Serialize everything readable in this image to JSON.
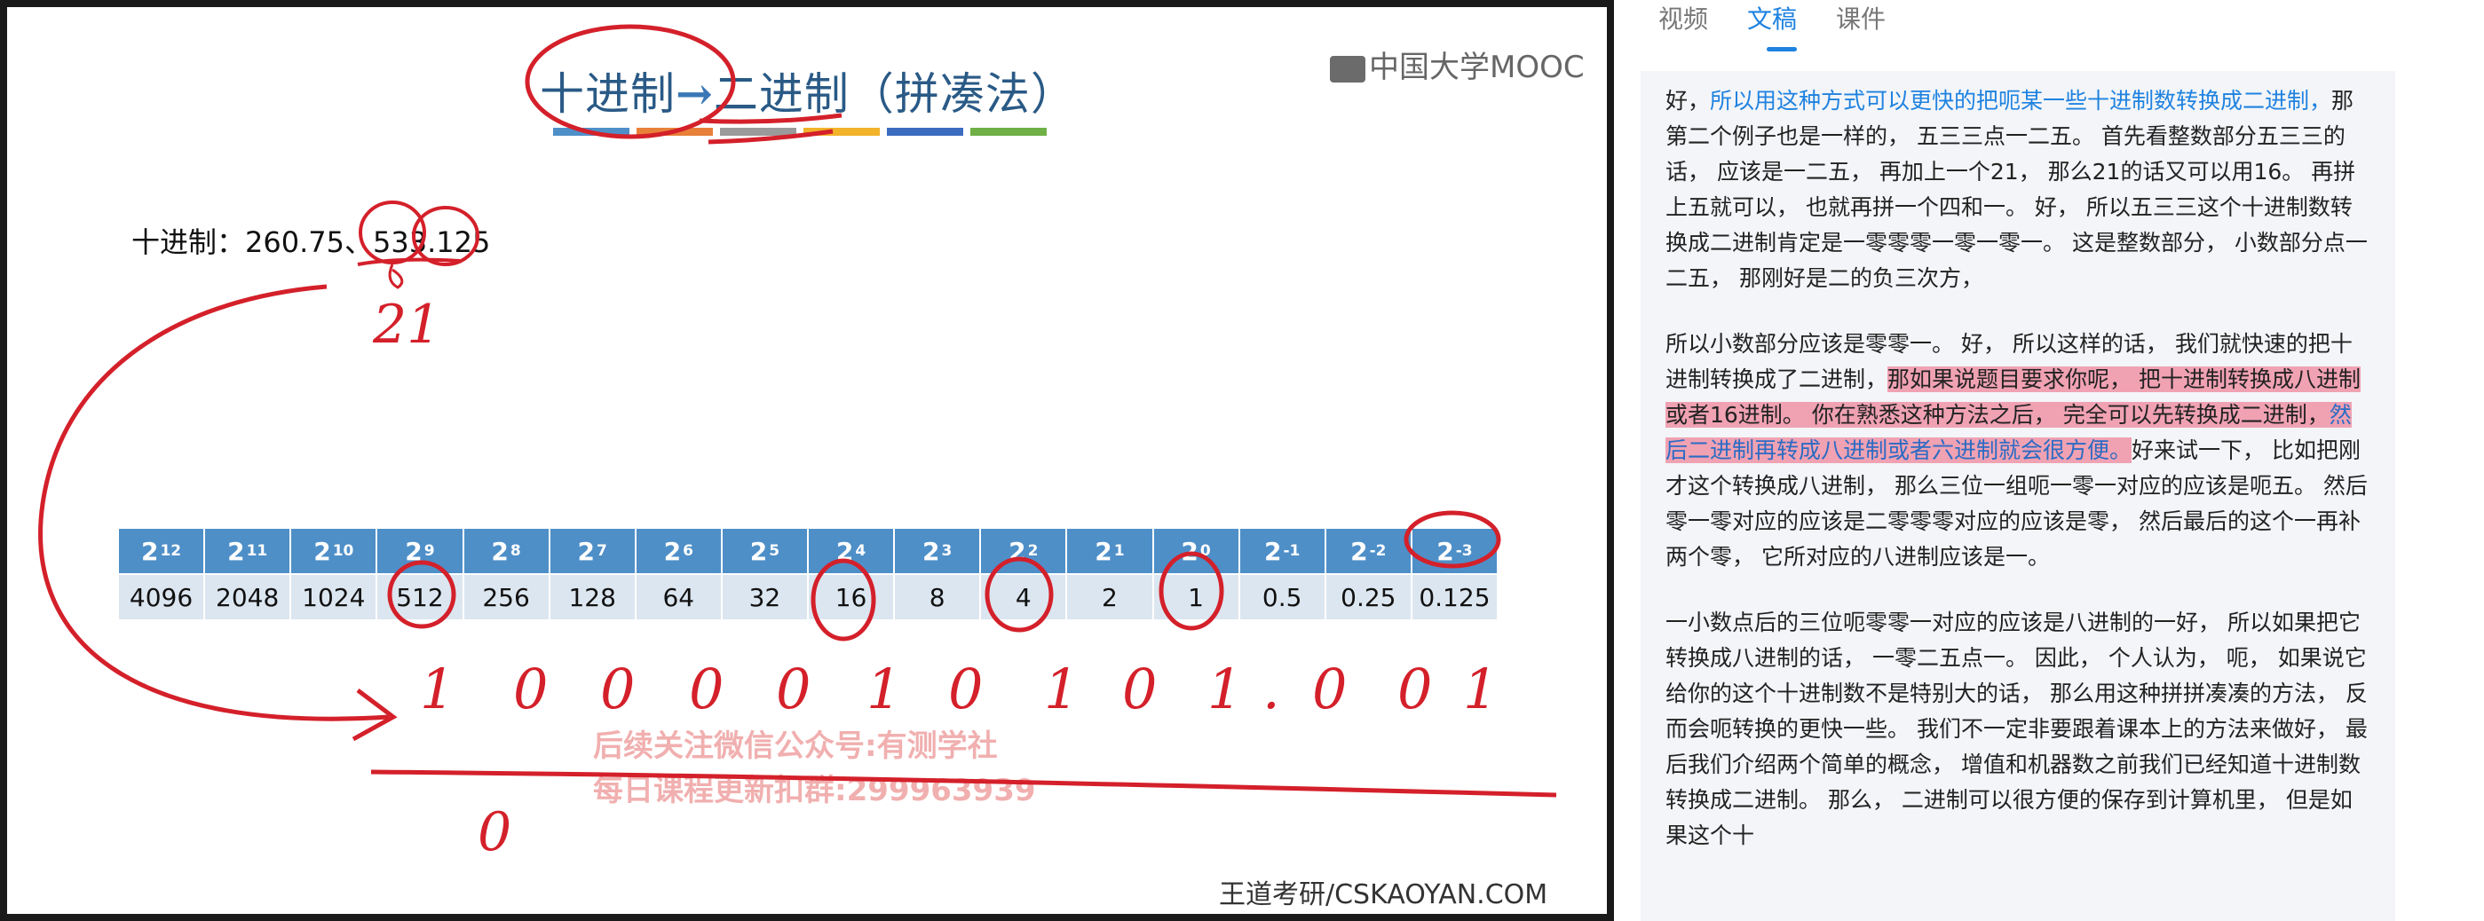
{
  "slide": {
    "title_left": "十进制",
    "title_arrow": "→",
    "title_right": "二进制（拼凑法）",
    "title_bar_colors": [
      "#4e8fc8",
      "#e8803a",
      "#9a9a9a",
      "#f2b32a",
      "#3b6cc0",
      "#6fb047"
    ],
    "logo": "中国大学MOOC",
    "decimal_label": "十进制：",
    "decimal_values": "260.75、533.125",
    "powers": [
      {
        "base": "2",
        "exp": "12"
      },
      {
        "base": "2",
        "exp": "11"
      },
      {
        "base": "2",
        "exp": "10"
      },
      {
        "base": "2",
        "exp": "9"
      },
      {
        "base": "2",
        "exp": "8"
      },
      {
        "base": "2",
        "exp": "7"
      },
      {
        "base": "2",
        "exp": "6"
      },
      {
        "base": "2",
        "exp": "5"
      },
      {
        "base": "2",
        "exp": "4"
      },
      {
        "base": "2",
        "exp": "3"
      },
      {
        "base": "2",
        "exp": "2"
      },
      {
        "base": "2",
        "exp": "1"
      },
      {
        "base": "2",
        "exp": "0"
      },
      {
        "base": "2",
        "exp": "-1"
      },
      {
        "base": "2",
        "exp": "-2"
      },
      {
        "base": "2",
        "exp": "-3"
      }
    ],
    "values": [
      "4096",
      "2048",
      "1024",
      "512",
      "256",
      "128",
      "64",
      "32",
      "16",
      "8",
      "4",
      "2",
      "1",
      "0.5",
      "0.25",
      "0.125"
    ],
    "handwritten_sum": "21",
    "handwritten_binary": [
      "1",
      "0",
      "0",
      "0",
      "0",
      "1",
      "0",
      "1",
      "0",
      "1",
      ".",
      "0",
      "0",
      "1"
    ],
    "handwritten_extra": "0",
    "watermark_line1": "后续关注微信公众号:有测学社",
    "watermark_line2": "每日课程更新扣群:299963939",
    "site": "王道考研/CSKAOYAN.COM"
  },
  "panel": {
    "tabs": [
      {
        "label": "视频",
        "active": false
      },
      {
        "label": "文稿",
        "active": true
      },
      {
        "label": "课件",
        "active": false
      }
    ],
    "p1_plain_a": "好，",
    "p1_blue": "所以用这种方式可以更快的把呃某一些十进制数转换成二进制，",
    "p1_plain_b": "那第二个例子也是一样的， 五三三点一二五。 首先看整数部分五三三的话， 应该是一二五， 再加上一个21， 那么21的话又可以用16。 再拼上五就可以， 也就再拼一个四和一。 好， 所以五三三这个十进制数转换成二进制肯定是一零零零一零一零一。 这是整数部分， 小数部分点一二五， 那刚好是二的负三次方，",
    "p2_plain_a": "所以小数部分应该是零零一。 好， 所以这样的话， 我们就快速的把十进制转换成了二进制，",
    "p2_hl": "那如果说题目要求你呢， 把十进制转换成八进制或者16进制。 你在熟悉这种方法之后， 完全可以先转换成二进制，",
    "p2_hl_blue": "然后二进制再转成八进制或者六进制就会很方便。",
    "p2_plain_b": "好来试一下， 比如把刚才这个转换成八进制， 那么三位一组呃一零一对应的应该是呃五。 然后零一零对应的应该是二零零零对应的应该是零， 然后最后的这个一再补两个零， 它所对应的八进制应该是一。",
    "p3": "一小数点后的三位呃零零一对应的应该是八进制的一好， 所以如果把它转换成八进制的话， 一零二五点一。 因此， 个人认为， 呃， 如果说它给你的这个十进制数不是特别大的话， 那么用这种拼拼凑凑的方法， 反而会呃转换的更快一些。 我们不一定非要跟着课本上的方法来做好， 最后我们介绍两个简单的概念， 增值和机器数之前我们已经知道十进制数转换成二进制。 那么， 二进制可以很方便的保存到计算机里， 但是如果这个十"
  }
}
